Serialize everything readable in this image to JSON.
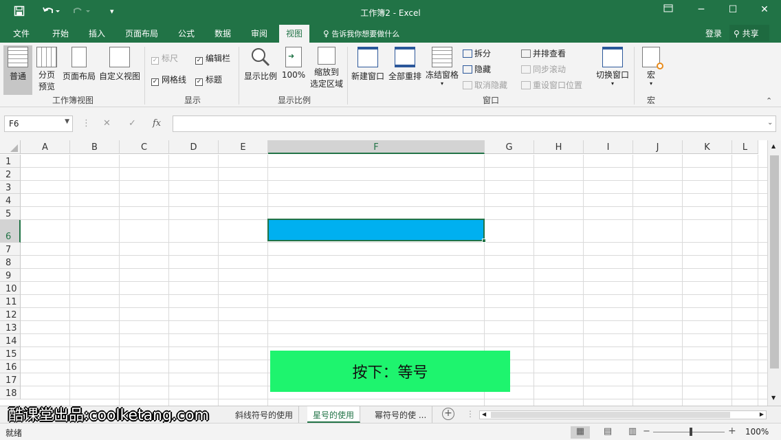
{
  "titlebar": {
    "title": "工作簿2 - Excel",
    "save_icon": "save-icon",
    "undo_icon": "undo-icon",
    "redo_icon": "redo-icon"
  },
  "tabs": [
    "文件",
    "开始",
    "插入",
    "页面布局",
    "公式",
    "数据",
    "审阅",
    "视图"
  ],
  "active_tab": "视图",
  "tellme": "告诉我你想要做什么",
  "login": "登录",
  "share": "共享",
  "ribbon": {
    "workbook_views": {
      "label": "工作簿视图",
      "normal": "普通",
      "pagebreak_line1": "分页",
      "pagebreak_line2": "预览",
      "page_layout": "页面布局",
      "custom": "自定义视图"
    },
    "show": {
      "label": "显示",
      "ruler": "标尺",
      "formula_bar": "编辑栏",
      "gridlines": "网格线",
      "headings": "标题"
    },
    "zoom": {
      "label": "显示比例",
      "zoom": "显示比例",
      "hundred": "100%",
      "to_sel_line1": "缩放到",
      "to_sel_line2": "选定区域"
    },
    "window": {
      "label": "窗口",
      "new_window": "新建窗口",
      "arrange_all": "全部重排",
      "freeze": "冻结窗格",
      "split": "拆分",
      "hide": "隐藏",
      "unhide": "取消隐藏",
      "side_by_side": "并排查看",
      "sync_scroll": "同步滚动",
      "reset_pos": "重设窗口位置",
      "switch": "切换窗口"
    },
    "macros": {
      "label": "宏",
      "macros": "宏"
    }
  },
  "namebox": "F6",
  "fx": "fx",
  "columns": [
    "A",
    "B",
    "C",
    "D",
    "E",
    "F",
    "G",
    "H",
    "I",
    "J",
    "K",
    "L"
  ],
  "rows": [
    "1",
    "2",
    "3",
    "4",
    "5",
    "6",
    "7",
    "8",
    "9",
    "10",
    "11",
    "12",
    "13",
    "14",
    "15",
    "16",
    "17",
    "18"
  ],
  "active_cell": "F6",
  "selection_fill": "#00b0f0",
  "tip": "按下：等号",
  "sheet_tabs": [
    "斜线符号的使用",
    "星号的使用",
    "幂符号的使 ..."
  ],
  "active_sheet": "星号的使用",
  "watermark": "酷课堂出品:coolketang.com",
  "status": "就绪",
  "zoom_level": "100%"
}
